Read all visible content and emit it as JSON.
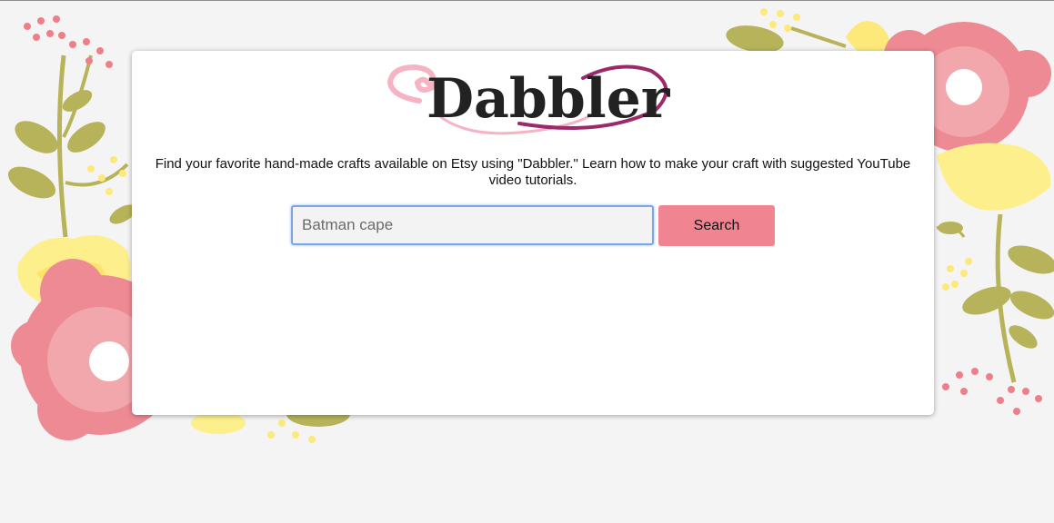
{
  "logo": {
    "text": "Dabbler",
    "colors": {
      "swirl_pink": "#f6b3c4",
      "swirl_magenta": "#9c2a6b",
      "text": "#222222"
    }
  },
  "tagline": "Find your favorite hand-made crafts available on Etsy using \"Dabbler.\" Learn how to make your craft with suggested YouTube video tutorials.",
  "search": {
    "placeholder": "Batman cape",
    "value": "",
    "button_label": "Search"
  },
  "theme": {
    "background": "#f4f4f4",
    "card": "#ffffff",
    "accent": "#f08591",
    "flower_pink": "#ee8a94",
    "flower_light_pink": "#f2a7ac",
    "flower_yellow": "#fdf08c",
    "leaf_green": "#b6b35b"
  }
}
